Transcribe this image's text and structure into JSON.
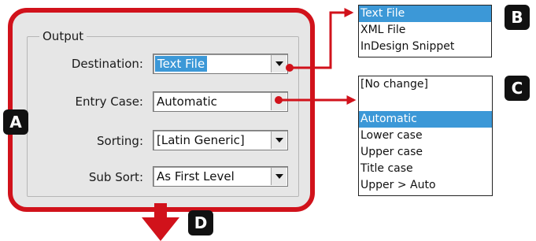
{
  "group": {
    "title": "Output"
  },
  "rows": [
    {
      "label": "Destination:",
      "value": "Text File"
    },
    {
      "label": "Entry Case:",
      "value": "Automatic"
    },
    {
      "label": "Sorting:",
      "value": "[Latin Generic]"
    },
    {
      "label": "Sub Sort:",
      "value": "As First Level"
    }
  ],
  "destination_list": {
    "items": [
      "Text File",
      "XML File",
      "InDesign Snippet"
    ],
    "selected": "Text File"
  },
  "entry_case_list": {
    "top_item": "[No change]",
    "items": [
      "Automatic",
      "Lower case",
      "Upper case",
      "Title case",
      "Upper > Auto"
    ],
    "selected": "Automatic"
  },
  "callouts": {
    "a": "A",
    "b": "B",
    "c": "C",
    "d": "D"
  },
  "colors": {
    "accent_red": "#d1121b",
    "selection_blue": "#3c98d7",
    "panel_gray": "#e6e6e6"
  },
  "icons": {
    "dropdown": "chevron-down-icon",
    "arrow": "arrow-down-icon"
  }
}
